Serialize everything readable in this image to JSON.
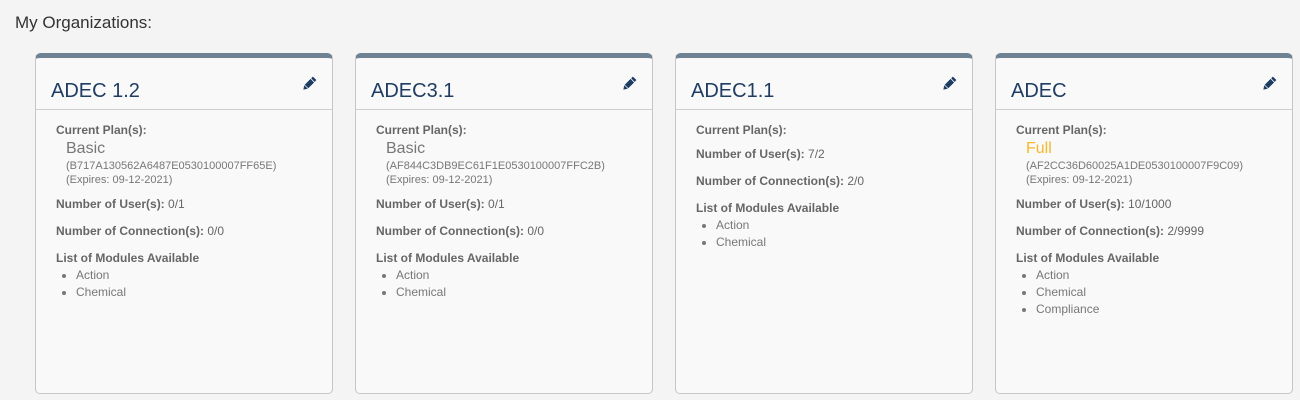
{
  "page": {
    "title": "My Organizations:"
  },
  "labels": {
    "plans": "Current Plan(s):",
    "users": "Number of User(s):",
    "connections": "Number of Connection(s):",
    "modules": "List of Modules Available"
  },
  "colors": {
    "header_bar": "#6e8294",
    "title_text": "#1f3c63",
    "full_plan": "#f5b92b"
  },
  "organizations": [
    {
      "name": "ADEC 1.2",
      "plan": {
        "name": "Basic",
        "id": "(B717A130562A6487E0530100007FF65E)",
        "expires": "(Expires: 09-12-2021)"
      },
      "users": "0/1",
      "connections": "0/0",
      "modules": [
        "Action",
        "Chemical"
      ]
    },
    {
      "name": "ADEC3.1",
      "plan": {
        "name": "Basic",
        "id": "(AF844C3DB9EC61F1E0530100007FFC2B)",
        "expires": "(Expires: 09-12-2021)"
      },
      "users": "0/1",
      "connections": "0/0",
      "modules": [
        "Action",
        "Chemical"
      ]
    },
    {
      "name": "ADEC1.1",
      "plan": null,
      "users": "7/2",
      "connections": "2/0",
      "modules": [
        "Action",
        "Chemical"
      ]
    },
    {
      "name": "ADEC",
      "plan": {
        "name": "Full",
        "id": "(AF2CC36D60025A1DE0530100007F9C09)",
        "expires": "(Expires: 09-12-2021)"
      },
      "users": "10/1000",
      "connections": "2/9999",
      "modules": [
        "Action",
        "Chemical",
        "Compliance"
      ]
    }
  ]
}
